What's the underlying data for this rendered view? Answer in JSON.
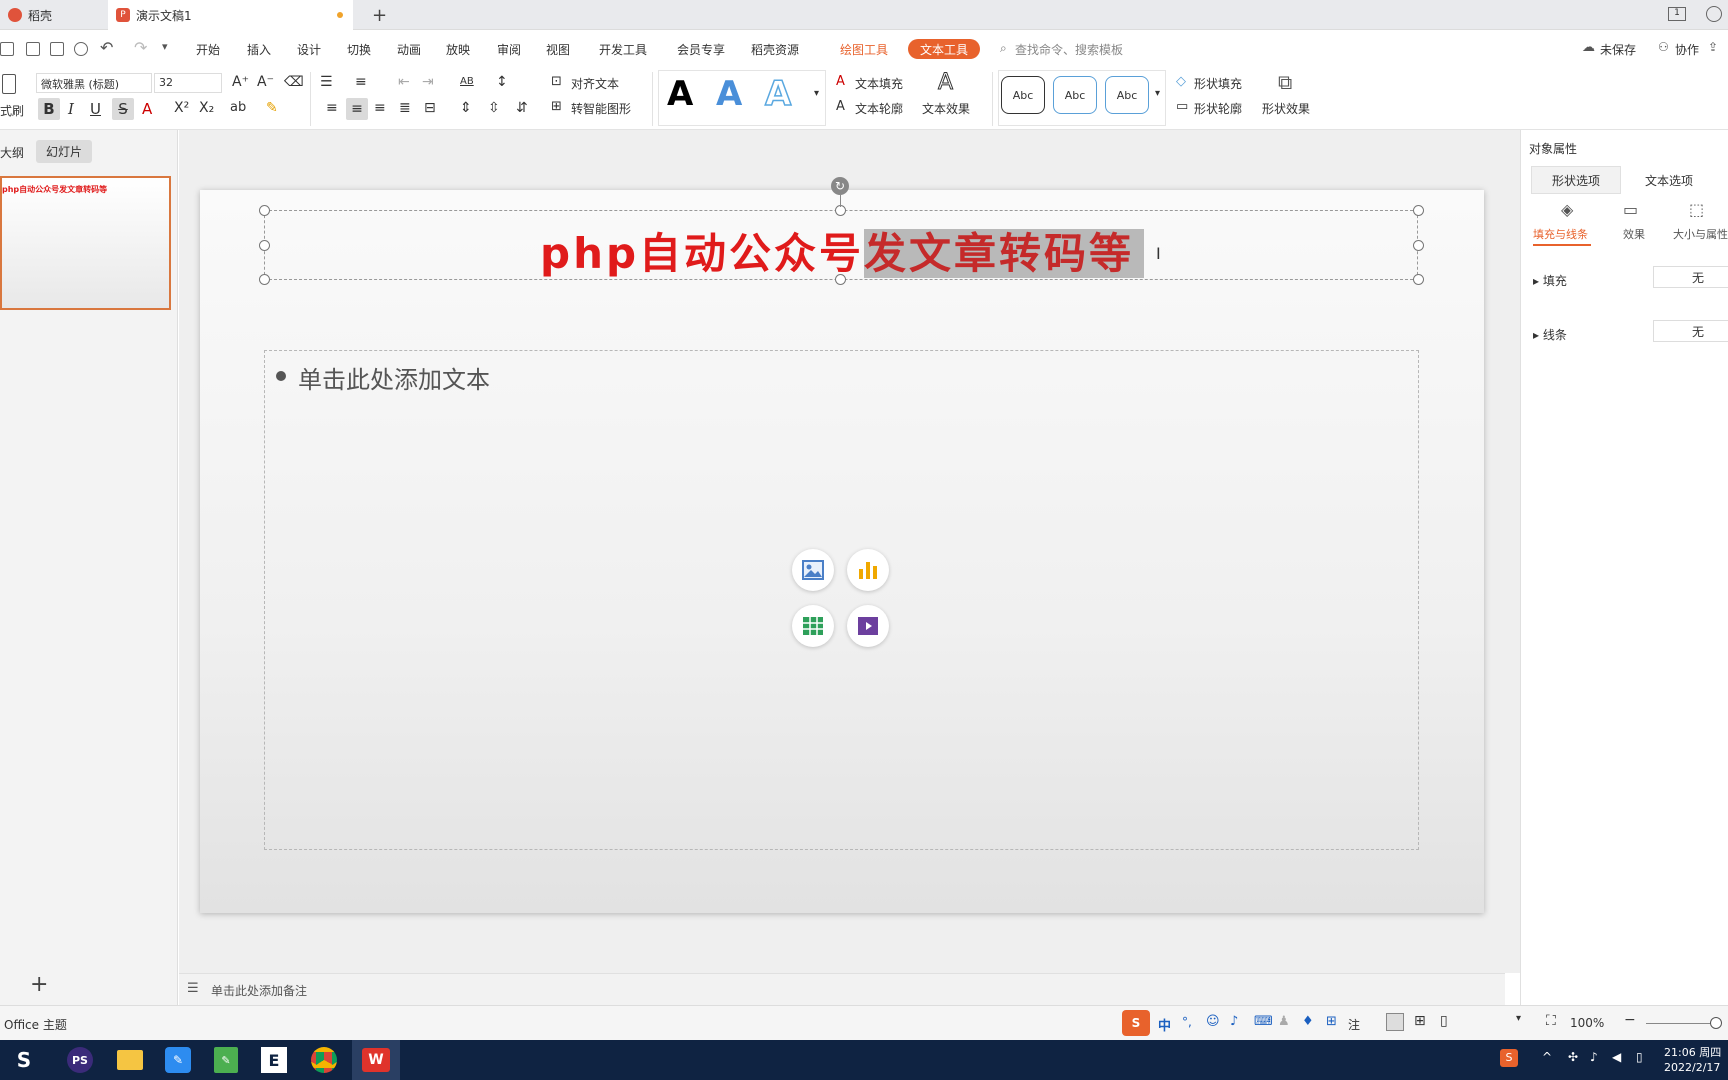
{
  "tabs": [
    {
      "label": "稻壳"
    },
    {
      "label": "演示文稿1"
    }
  ],
  "menu": {
    "items": [
      "开始",
      "插入",
      "设计",
      "切换",
      "动画",
      "放映",
      "审阅",
      "视图",
      "开发工具",
      "会员专享",
      "稻壳资源"
    ],
    "drawing_tools": "绘图工具",
    "text_tools": "文本工具",
    "search_placeholder": "查找命令、搜索模板",
    "unsaved": "未保存",
    "collab": "协作"
  },
  "ribbon": {
    "format_painter": "式刷",
    "font_name": "微软雅黑 (标题)",
    "font_size": "32",
    "align_text": "对齐文本",
    "smart_shape": "转智能图形",
    "text_fill": "文本填充",
    "text_outline": "文本轮廓",
    "text_effect": "文本效果",
    "abc": [
      "Abc",
      "Abc",
      "Abc"
    ],
    "shape_fill": "形状填充",
    "shape_outline": "形状轮廓",
    "shape_effect": "形状效果",
    "ab_label": "AB"
  },
  "left_panel": {
    "outline_tab": "大纲",
    "slides_tab": "幻灯片",
    "thumb_title": "php自动公众号发文章转码等"
  },
  "slide": {
    "title_plain": "php自动公众号",
    "title_selected": "发文章转码等",
    "body_placeholder": "单击此处添加文本"
  },
  "notes": {
    "placeholder": "单击此处添加备注"
  },
  "right_panel": {
    "header": "对象属性",
    "tab_shape": "形状选项",
    "tab_text": "文本选项",
    "sub_fill_line": "填充与线条",
    "sub_effect": "效果",
    "sub_size": "大小与属性",
    "fill_label": "填充",
    "fill_value": "无",
    "line_label": "线条",
    "line_value": "无"
  },
  "status": {
    "theme": "Office 主题",
    "zoom": "100%",
    "notes_partial": "注"
  },
  "ime": {
    "lang": "中"
  },
  "taskbar": {
    "time": "21:06 周四",
    "date": "2022/2/17"
  },
  "colors": {
    "accent": "#e8622c",
    "title_red": "#e01b1b",
    "taskbar": "#0f2342"
  }
}
